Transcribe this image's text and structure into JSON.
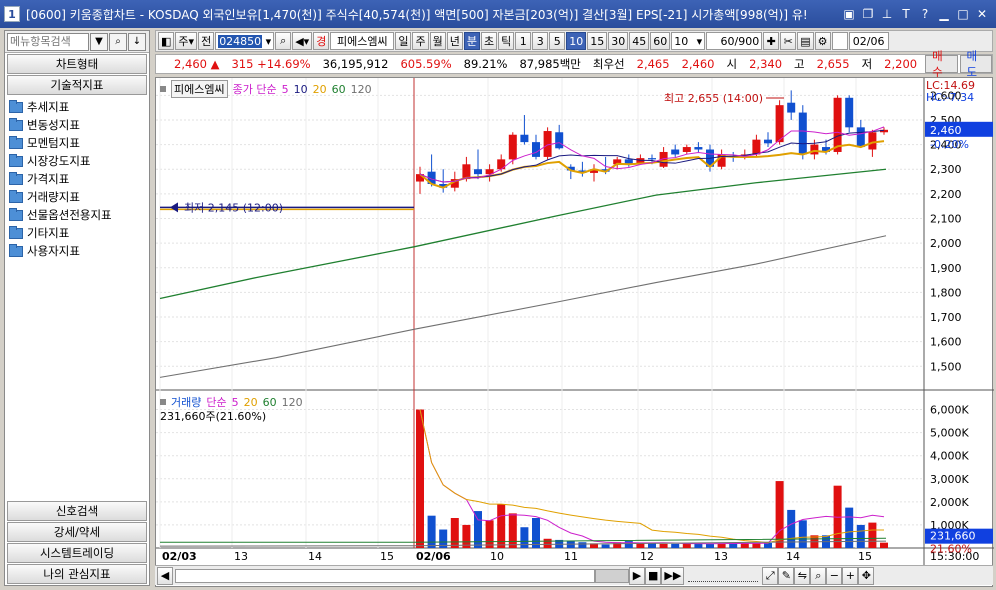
{
  "window": {
    "title": "[0600] 키움종합차트 - KOSDAQ 외국인보유[1,470(천)] 주식수[40,574(천)] 액면[500] 자본금[203(억)] 결산[3월] EPS[-21] 시가총액[998(억)] 유!",
    "app_badge": "1"
  },
  "left": {
    "search_placeholder": "메뉴항목검색",
    "chart_type": "차트형태",
    "tech_indicators": "기술적지표",
    "tree": [
      "추세지표",
      "변동성지표",
      "모멘텀지표",
      "시장강도지표",
      "가격지표",
      "거래량지표",
      "선물옵션전용지표",
      "기타지표",
      "사용자지표"
    ],
    "bottom": [
      "신호검색",
      "강세/약세",
      "시스템트레이딩",
      "나의 관심지표"
    ]
  },
  "toolbar": {
    "market": "주",
    "prefix": "전",
    "code": "024850",
    "name_badge": "경",
    "name": "피에스엠씨",
    "periods": [
      "일",
      "주",
      "월",
      "년",
      "분",
      "초",
      "틱"
    ],
    "selected_period": "분",
    "intervals": [
      "1",
      "3",
      "5",
      "10",
      "15",
      "30",
      "45",
      "60"
    ],
    "selected_interval": "10",
    "interval_select": "10",
    "count": "60/900",
    "date": "02/06"
  },
  "info": {
    "price": "2,460",
    "change": "315",
    "change_pct": "+14.69%",
    "volume": "36,195,912",
    "volume_ratio": "605.59%",
    "turnover": "89.21%",
    "amount": "87,985백만",
    "best": "최우선",
    "ask": "2,465",
    "bid": "2,460",
    "open_label": "시",
    "open": "2,340",
    "high_label": "고",
    "high": "2,655",
    "low_label": "저",
    "low": "2,200",
    "buy": "매수",
    "sell": "매도"
  },
  "chart_data": {
    "type": "candlestick",
    "price_legend": {
      "name": "피에스엠씨",
      "ma_label": "종가 단순",
      "periods": [
        "5",
        "10",
        "20",
        "60",
        "120"
      ]
    },
    "volume_legend": {
      "name": "거래량",
      "ma_label": "단순",
      "periods": [
        "5",
        "20",
        "60",
        "120"
      ],
      "value": "231,660주(21.60%)"
    },
    "colors": {
      "up": "#e01010",
      "down": "#1050d0",
      "ma5": "#cc20cc",
      "ma10": "#1a1a80",
      "ma20": "#e0a000",
      "ma60": "#208030",
      "ma120": "#707070"
    },
    "y_ticks": [
      "2,600",
      "2,500",
      "2,400",
      "2,300",
      "2,200",
      "2,100",
      "2,000",
      "1,900",
      "1,800",
      "1,700",
      "1,600",
      "1,500"
    ],
    "y_min": 1420,
    "y_max": 2650,
    "vol_ticks": [
      "6,000K",
      "5,000K",
      "4,000K",
      "3,000K",
      "2,000K",
      "1,000K"
    ],
    "vol_max": 6500,
    "corner_labels": {
      "lc": "LC:14.69",
      "hc": "HC:-7.34",
      "price_tag": "2,460",
      "pct_tag": "-0.20%",
      "vol_tag": "231,660",
      "vol_pct_tag": "21.60%"
    },
    "max_annotation": "최고 2,655 (14:00)",
    "min_annotation": "최저 2,145 (12:00)",
    "x_labels": [
      "02/03",
      "13",
      "14",
      "15",
      "02/06",
      "10",
      "11",
      "12",
      "13",
      "14",
      "15"
    ],
    "time_label": "15:30:00",
    "flat_price": 2145,
    "candles": [
      {
        "o": 2250,
        "h": 2310,
        "l": 2200,
        "c": 2280
      },
      {
        "o": 2290,
        "h": 2360,
        "l": 2230,
        "c": 2240
      },
      {
        "o": 2240,
        "h": 2300,
        "l": 2205,
        "c": 2225
      },
      {
        "o": 2225,
        "h": 2290,
        "l": 2210,
        "c": 2260
      },
      {
        "o": 2260,
        "h": 2350,
        "l": 2250,
        "c": 2320
      },
      {
        "o": 2300,
        "h": 2380,
        "l": 2260,
        "c": 2280
      },
      {
        "o": 2280,
        "h": 2320,
        "l": 2250,
        "c": 2300
      },
      {
        "o": 2300,
        "h": 2360,
        "l": 2290,
        "c": 2340
      },
      {
        "o": 2340,
        "h": 2450,
        "l": 2320,
        "c": 2440
      },
      {
        "o": 2440,
        "h": 2520,
        "l": 2400,
        "c": 2410
      },
      {
        "o": 2410,
        "h": 2440,
        "l": 2340,
        "c": 2350
      },
      {
        "o": 2350,
        "h": 2470,
        "l": 2340,
        "c": 2455
      },
      {
        "o": 2450,
        "h": 2480,
        "l": 2380,
        "c": 2385
      },
      {
        "o": 2310,
        "h": 2320,
        "l": 2260,
        "c": 2295
      },
      {
        "o": 2295,
        "h": 2330,
        "l": 2270,
        "c": 2285
      },
      {
        "o": 2285,
        "h": 2320,
        "l": 2250,
        "c": 2300
      },
      {
        "o": 2300,
        "h": 2350,
        "l": 2280,
        "c": 2290
      },
      {
        "o": 2320,
        "h": 2350,
        "l": 2300,
        "c": 2340
      },
      {
        "o": 2340,
        "h": 2360,
        "l": 2310,
        "c": 2320
      },
      {
        "o": 2320,
        "h": 2360,
        "l": 2320,
        "c": 2345
      },
      {
        "o": 2345,
        "h": 2360,
        "l": 2320,
        "c": 2340
      },
      {
        "o": 2310,
        "h": 2390,
        "l": 2305,
        "c": 2370
      },
      {
        "o": 2380,
        "h": 2400,
        "l": 2350,
        "c": 2360
      },
      {
        "o": 2370,
        "h": 2400,
        "l": 2360,
        "c": 2390
      },
      {
        "o": 2390,
        "h": 2410,
        "l": 2370,
        "c": 2380
      },
      {
        "o": 2380,
        "h": 2400,
        "l": 2290,
        "c": 2310
      },
      {
        "o": 2310,
        "h": 2380,
        "l": 2300,
        "c": 2360
      },
      {
        "o": 2355,
        "h": 2370,
        "l": 2330,
        "c": 2350
      },
      {
        "o": 2350,
        "h": 2380,
        "l": 2340,
        "c": 2360
      },
      {
        "o": 2360,
        "h": 2440,
        "l": 2350,
        "c": 2420
      },
      {
        "o": 2420,
        "h": 2450,
        "l": 2390,
        "c": 2405
      },
      {
        "o": 2410,
        "h": 2580,
        "l": 2400,
        "c": 2560
      },
      {
        "o": 2570,
        "h": 2620,
        "l": 2500,
        "c": 2530
      },
      {
        "o": 2530,
        "h": 2560,
        "l": 2340,
        "c": 2360
      },
      {
        "o": 2360,
        "h": 2420,
        "l": 2340,
        "c": 2400
      },
      {
        "o": 2390,
        "h": 2420,
        "l": 2360,
        "c": 2370
      },
      {
        "o": 2370,
        "h": 2600,
        "l": 2360,
        "c": 2590
      },
      {
        "o": 2590,
        "h": 2600,
        "l": 2450,
        "c": 2470
      },
      {
        "o": 2470,
        "h": 2500,
        "l": 2390,
        "c": 2390
      },
      {
        "o": 2380,
        "h": 2460,
        "l": 2350,
        "c": 2450
      },
      {
        "o": 2450,
        "h": 2470,
        "l": 2440,
        "c": 2460
      }
    ],
    "volumes": [
      6000,
      1400,
      800,
      1300,
      1000,
      1600,
      1200,
      1900,
      1500,
      900,
      1300,
      400,
      350,
      300,
      250,
      200,
      150,
      250,
      300,
      220,
      200,
      180,
      180,
      180,
      200,
      180,
      200,
      220,
      200,
      200,
      220,
      2900,
      1650,
      1200,
      550,
      550,
      2700,
      1750,
      1000,
      1100,
      231
    ]
  }
}
